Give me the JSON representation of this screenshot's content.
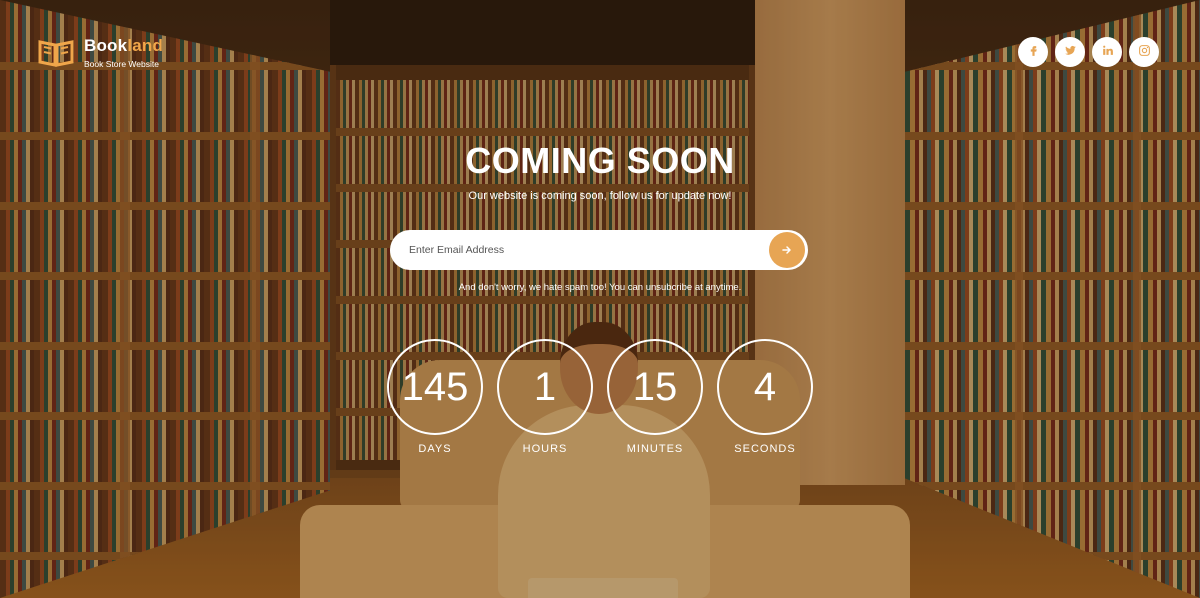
{
  "brand": {
    "name_main": "Book",
    "name_accent": "land",
    "tagline": "Book Store Website",
    "accent_color": "#e7a554"
  },
  "social": [
    {
      "icon": "facebook-icon",
      "glyph": "f"
    },
    {
      "icon": "twitter-icon",
      "glyph": "t"
    },
    {
      "icon": "linkedin-icon",
      "glyph": "in"
    },
    {
      "icon": "instagram-icon",
      "glyph": "ig"
    }
  ],
  "hero": {
    "title": "COMING SOON",
    "subtitle": "Our website is coming soon, follow us for update now!"
  },
  "subscribe": {
    "placeholder": "Enter Email Address",
    "submit_icon": "arrow-right-icon",
    "note": "And don't worry, we hate spam too! You can unsubcribe at anytime."
  },
  "countdown": {
    "days": {
      "value": "145",
      "label": "DAYS"
    },
    "hours": {
      "value": "1",
      "label": "HOURS"
    },
    "minutes": {
      "value": "15",
      "label": "MINUTES"
    },
    "seconds": {
      "value": "4",
      "label": "SECONDS"
    }
  }
}
